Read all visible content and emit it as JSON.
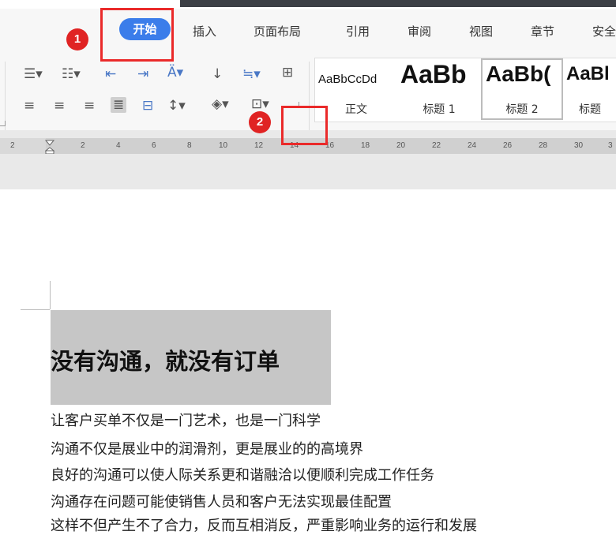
{
  "ribbon": {
    "tabs": [
      {
        "label": "开始",
        "active": true
      },
      {
        "label": "插入"
      },
      {
        "label": "页面布局"
      },
      {
        "label": "引用"
      },
      {
        "label": "审阅"
      },
      {
        "label": "视图"
      },
      {
        "label": "章节"
      },
      {
        "label": "安全"
      }
    ]
  },
  "styles": [
    {
      "sample": "AaBbCcDd",
      "label": "正文"
    },
    {
      "sample": "AaBb",
      "label": "标题 1"
    },
    {
      "sample": "AaBb(",
      "label": "标题 2",
      "selected": true
    },
    {
      "sample": "AaBl",
      "label": "标题"
    }
  ],
  "ruler": {
    "labels": [
      "2",
      "2",
      "4",
      "6",
      "8",
      "10",
      "12",
      "14",
      "16",
      "18",
      "20",
      "22",
      "24",
      "26",
      "28",
      "30",
      "3"
    ]
  },
  "document": {
    "heading": "没有沟通，就没有订单",
    "paragraphs": [
      "让客户买单不仅是一门艺术，也是一门科学",
      "沟通不仅是展业中的润滑剂，更是展业的的高境界",
      "良好的沟通可以使人际关系更和谐融洽以便顺利完成工作任务",
      "沟通存在问题可能使销售人员和客户无法实现最佳配置",
      "这样不但产生不了合力，反而互相消反，严重影响业务的运行和发展"
    ]
  },
  "annotations": {
    "badge1": "1",
    "badge2": "2",
    "accent": "#3b7dea",
    "marker_color": "#e02323"
  }
}
